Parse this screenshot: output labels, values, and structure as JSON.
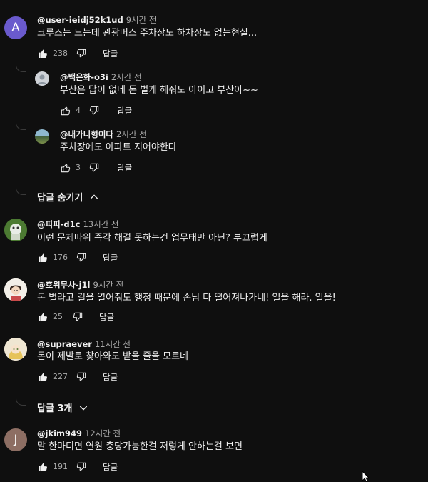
{
  "icons": {
    "like": "thumbs-up-icon",
    "dislike": "thumbs-down-icon",
    "expand": "chevron-down-icon",
    "collapse": "chevron-up-icon",
    "cursor": "mouse-pointer-icon"
  },
  "comments": [
    {
      "avatar_letter": "A",
      "avatar_color": "#6a5acd",
      "handle": "@user-ieidj52k1ud",
      "time": "9시간 전",
      "text": "크루즈는 느는데 관광버스 주차장도 하차장도 없는현실...",
      "likes": "238",
      "reply_label": "답글",
      "replies": [
        {
          "handle": "@백은화-o3i",
          "time": "2시간 전",
          "text": "부산은 답이 없네 돈 벌게 해줘도 아이고 부산아~~",
          "likes": "4",
          "reply_label": "답글"
        },
        {
          "handle": "@내가니형이다",
          "time": "2시간 전",
          "text": "주차장에도 아파트 지어야한다",
          "likes": "3",
          "reply_label": "답글"
        }
      ],
      "toggle_label": "답글 숨기기"
    },
    {
      "handle": "@피피-d1c",
      "time": "13시간 전",
      "text": "이런 문제따위 즉각 해결 못하는건 업무태만 아닌? 부끄럽게",
      "likes": "176",
      "reply_label": "답글"
    },
    {
      "handle": "@호위무사-j1l",
      "time": "9시간 전",
      "text": "돈 벌라고 길을 열어줘도 행정 때문에 손님 다 떨어져나가네! 일을 해라. 일을!",
      "likes": "25",
      "reply_label": "답글"
    },
    {
      "handle": "@supraever",
      "time": "11시간 전",
      "text": "돈이 제발로 찾아와도 받을 줄을 모르네",
      "likes": "227",
      "reply_label": "답글",
      "toggle_label": "답글 3개"
    },
    {
      "avatar_letter": "J",
      "avatar_color": "#8d6e63",
      "handle": "@jkim949",
      "time": "12시간 전",
      "text": "말 한마디면 연원 충당가능한걸 저렇게 안하는걸 보면",
      "likes": "191",
      "reply_label": "답글"
    }
  ]
}
